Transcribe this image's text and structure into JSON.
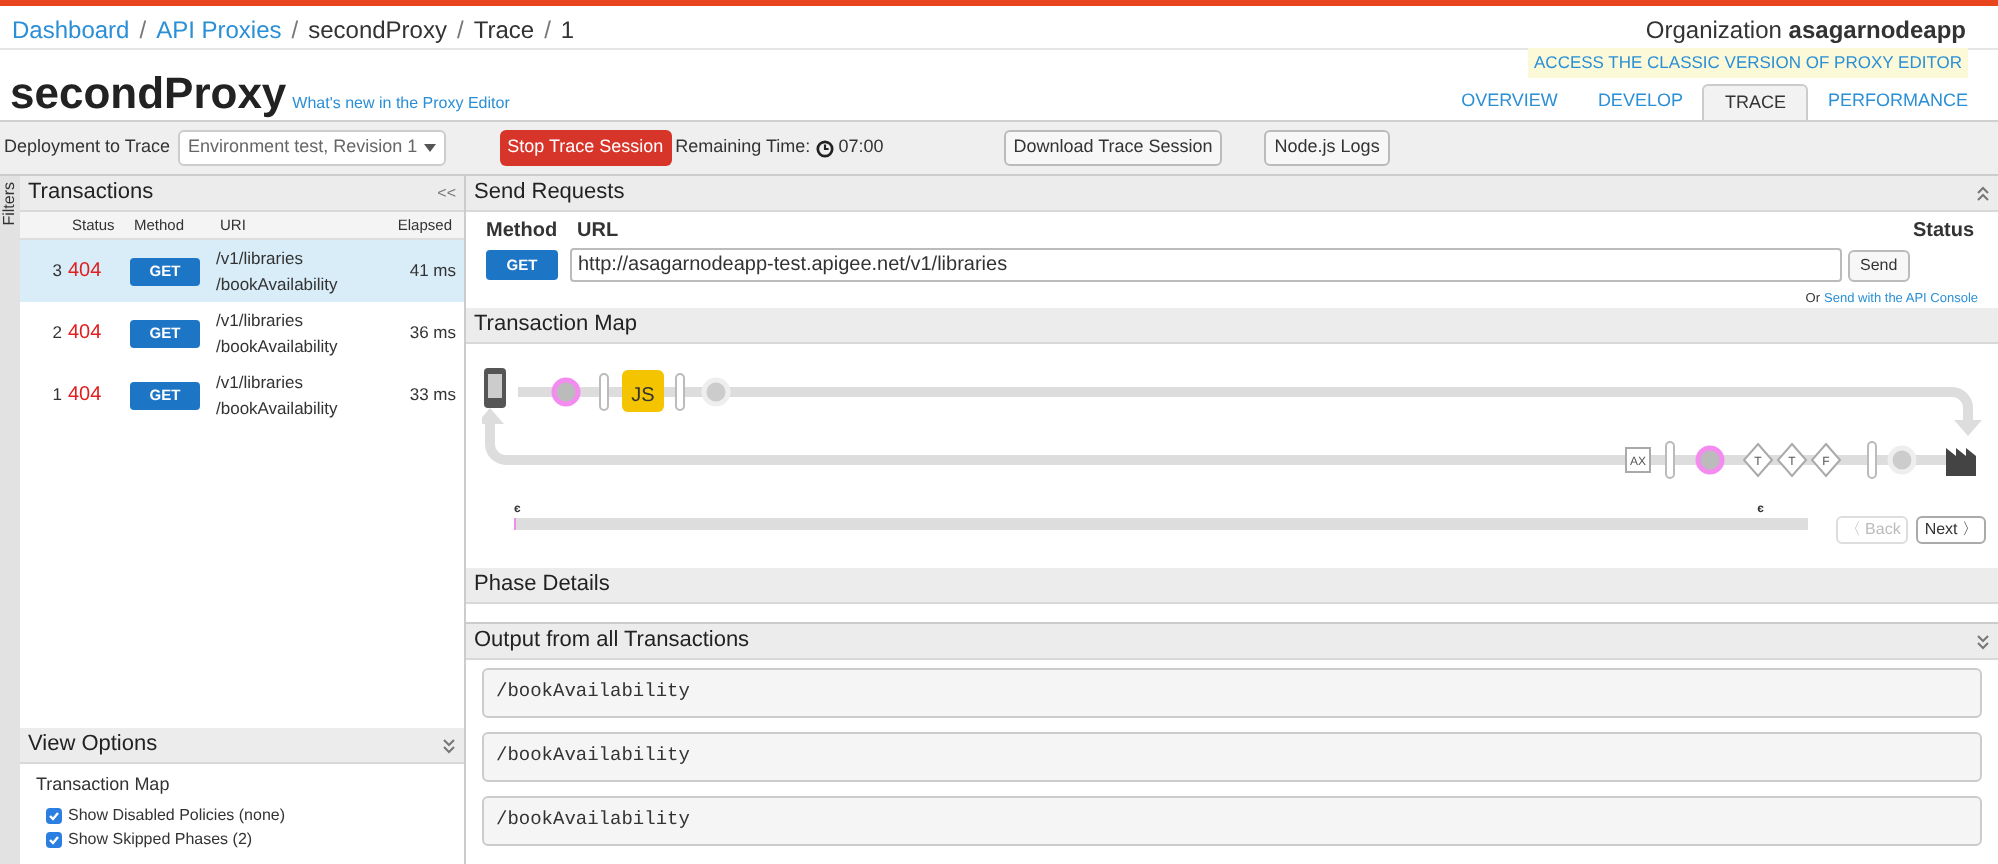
{
  "breadcrumb_separator": "/",
  "breadcrumb": [
    {
      "label": "Dashboard",
      "link": true
    },
    {
      "label": "API Proxies",
      "link": true
    },
    {
      "label": "secondProxy",
      "link": false
    },
    {
      "label": "Trace",
      "link": false
    },
    {
      "label": "1",
      "link": false
    }
  ],
  "organization": {
    "label": "Organization",
    "name": "asagarnodeapp"
  },
  "title": "secondProxy",
  "whats_new": "What's new in the Proxy Editor",
  "classic_link": "ACCESS THE CLASSIC VERSION OF PROXY EDITOR",
  "tabs": [
    {
      "label": "OVERVIEW",
      "selected": false
    },
    {
      "label": "DEVELOP",
      "selected": false
    },
    {
      "label": "TRACE",
      "selected": true
    },
    {
      "label": "PERFORMANCE",
      "selected": false
    }
  ],
  "toolbar": {
    "deployment_label": "Deployment to Trace",
    "deployment_value": "Environment test, Revision 1",
    "stop_button": "Stop Trace Session",
    "remaining_label": "Remaining Time:",
    "remaining_value": "07:00",
    "download_button": "Download Trace Session",
    "logs_button": "Node.js Logs"
  },
  "filters_label": "Filters",
  "transactions": {
    "title": "Transactions",
    "collapse": "<<",
    "columns": [
      "Status",
      "Method",
      "URI",
      "Elapsed"
    ],
    "rows": [
      {
        "number": "3",
        "status": "404",
        "method": "GET",
        "uri_1": "/v1/libraries",
        "uri_2": "/bookAvailability",
        "elapsed": "41 ms",
        "selected": true
      },
      {
        "number": "2",
        "status": "404",
        "method": "GET",
        "uri_1": "/v1/libraries",
        "uri_2": "/bookAvailability",
        "elapsed": "36 ms",
        "selected": false
      },
      {
        "number": "1",
        "status": "404",
        "method": "GET",
        "uri_1": "/v1/libraries",
        "uri_2": "/bookAvailability",
        "elapsed": "33 ms",
        "selected": false
      }
    ]
  },
  "view_options": {
    "title": "View Options",
    "section": "Transaction Map",
    "options": [
      {
        "label": "Show Disabled Policies (none)",
        "checked": true
      },
      {
        "label": "Show Skipped Phases (2)",
        "checked": true
      }
    ]
  },
  "send_requests": {
    "title": "Send Requests",
    "method_label": "Method",
    "url_label": "URL",
    "status_label": "Status",
    "method": "GET",
    "url": "http://asagarnodeapp-test.apigee.net/v1/libraries",
    "send_button": "Send",
    "console_prefix": "Or",
    "console_link": "Send with the API Console"
  },
  "transaction_map": {
    "title": "Transaction Map",
    "request_policies": [
      "JS"
    ],
    "response_policies": [
      {
        "label": "AX",
        "kind": "square"
      },
      {
        "label": "T",
        "kind": "diamond"
      },
      {
        "label": "T",
        "kind": "diamond"
      },
      {
        "label": "F",
        "kind": "diamond"
      }
    ],
    "marker_start": "є",
    "marker_end": "є",
    "back_button": "〈 Back",
    "next_button": "Next 〉",
    "back_disabled": true
  },
  "phase_details": {
    "title": "Phase Details"
  },
  "output": {
    "title": "Output from all Transactions",
    "items": [
      "/bookAvailability",
      "/bookAvailability",
      "/bookAvailability"
    ]
  }
}
